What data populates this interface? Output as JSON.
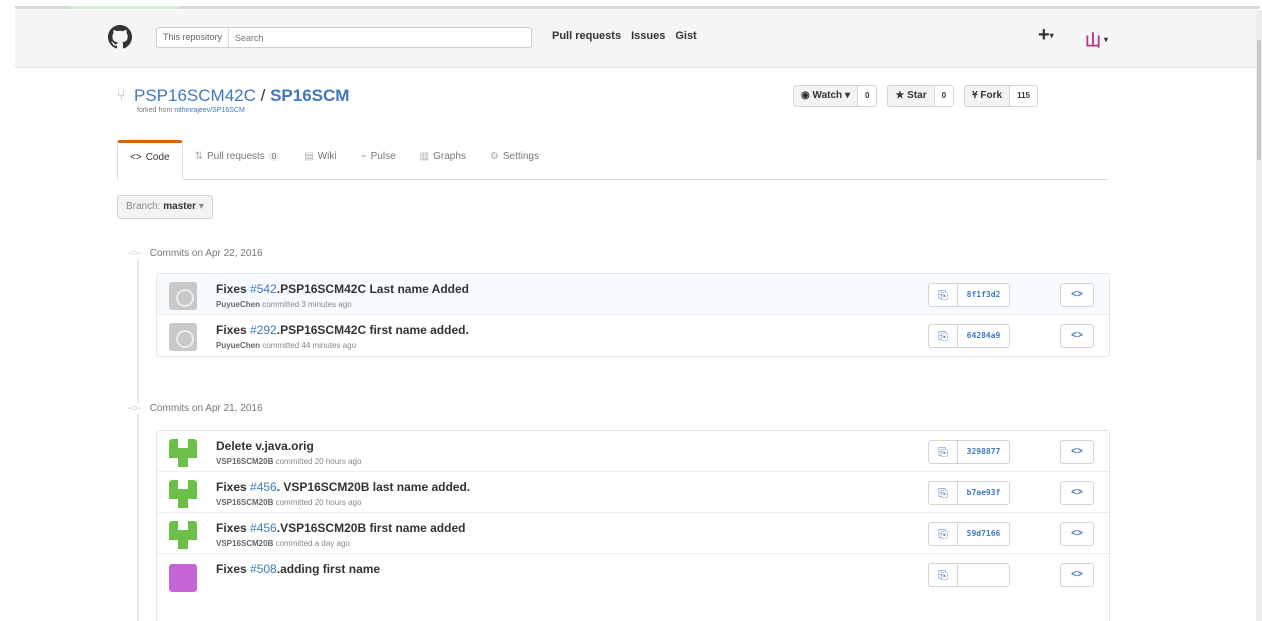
{
  "header": {
    "scope_label": "This repository",
    "search_placeholder": "Search",
    "nav": [
      "Pull requests",
      "Issues",
      "Gist"
    ],
    "plus_icon": "+",
    "user_icon": "山"
  },
  "repo": {
    "owner": "PSP16SCM42C",
    "separator": "/",
    "name": "SP16SCM",
    "forked_prefix": "forked from",
    "forked_from": "nithinrajeev/SP16SCM"
  },
  "actions": {
    "watch_label": "Watch",
    "watch_count": "0",
    "star_label": "Star",
    "star_count": "0",
    "fork_label": "Fork",
    "fork_count": "115"
  },
  "tabs": {
    "code": "Code",
    "pull_requests": "Pull requests",
    "pull_requests_count": "0",
    "wiki": "Wiki",
    "pulse": "Pulse",
    "graphs": "Graphs",
    "settings": "Settings"
  },
  "branch": {
    "label": "Branch:",
    "name": "master"
  },
  "day_groups": [
    {
      "date_label": "Commits on Apr 22, 2016",
      "commits": [
        {
          "msg_prefix": "Fixes ",
          "issue": "#542",
          "msg_rest": ".PSP16SCM42C Last name Added",
          "author": "PuyueChen",
          "time": "committed 3 minutes ago",
          "sha": "8f1f3d2"
        },
        {
          "msg_prefix": "Fixes ",
          "issue": "#292",
          "msg_rest": ".PSP16SCM42C first name added.",
          "author": "PuyueChen",
          "time": "committed 44 minutes ago",
          "sha": "64284a9"
        }
      ]
    },
    {
      "date_label": "Commits on Apr 21, 2016",
      "commits": [
        {
          "msg_prefix": "Delete v.java.orig",
          "issue": "",
          "msg_rest": "",
          "author": "VSP16SCM20B",
          "time": "committed 20 hours ago",
          "sha": "3298877"
        },
        {
          "msg_prefix": "Fixes ",
          "issue": "#456",
          "msg_rest": ". VSP16SCM20B last name added.",
          "author": "VSP16SCM20B",
          "time": "committed 20 hours ago",
          "sha": "b7ae93f"
        },
        {
          "msg_prefix": "Fixes ",
          "issue": "#456",
          "msg_rest": ".VSP16SCM20B first name added",
          "author": "VSP16SCM20B",
          "time": "committed a day ago",
          "sha": "59d7166"
        },
        {
          "msg_prefix": "Fixes ",
          "issue": "#508",
          "msg_rest": ".adding first name",
          "author": "",
          "time": "",
          "sha": ""
        }
      ]
    }
  ],
  "colors": {
    "link": "#4078c0",
    "tab_accent": "#d26911",
    "avatar_green": "#6cc04a",
    "avatar_purple": "#c665d6",
    "user_avatar": "#b8378f"
  },
  "icons": {
    "logo": "github-octocat-icon",
    "repo_forked": "repo-forked-icon",
    "eye": "eye-icon",
    "star": "star-icon",
    "fork": "fork-icon",
    "code": "code-icon",
    "pull_request": "pull-request-icon",
    "wiki": "book-icon",
    "pulse": "pulse-icon",
    "graph": "graph-icon",
    "gear": "gear-icon",
    "clipboard": "clipboard-icon",
    "browse": "code-browse-icon",
    "commit_dot": "git-commit-icon"
  }
}
